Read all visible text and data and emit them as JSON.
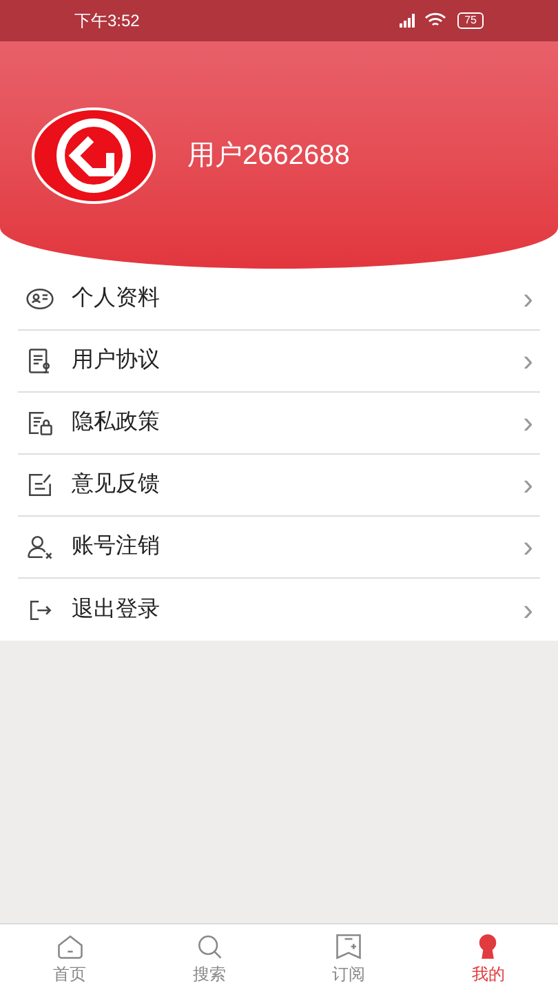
{
  "status_bar": {
    "time": "下午3:52",
    "battery": "75"
  },
  "profile": {
    "username": "用户2662688"
  },
  "menu": [
    {
      "kind": "profile",
      "label": "个人资料"
    },
    {
      "kind": "agreement",
      "label": "用户协议"
    },
    {
      "kind": "privacy",
      "label": "隐私政策"
    },
    {
      "kind": "feedback",
      "label": "意见反馈"
    },
    {
      "kind": "cancel",
      "label": "账号注销"
    },
    {
      "kind": "logout",
      "label": "退出登录"
    }
  ],
  "chevron": "›",
  "tabs": [
    {
      "kind": "home",
      "label": "首页",
      "selected": false
    },
    {
      "kind": "search",
      "label": "搜索",
      "selected": false
    },
    {
      "kind": "subscribe",
      "label": "订阅",
      "selected": false
    },
    {
      "kind": "mine",
      "label": "我的",
      "selected": true
    }
  ]
}
